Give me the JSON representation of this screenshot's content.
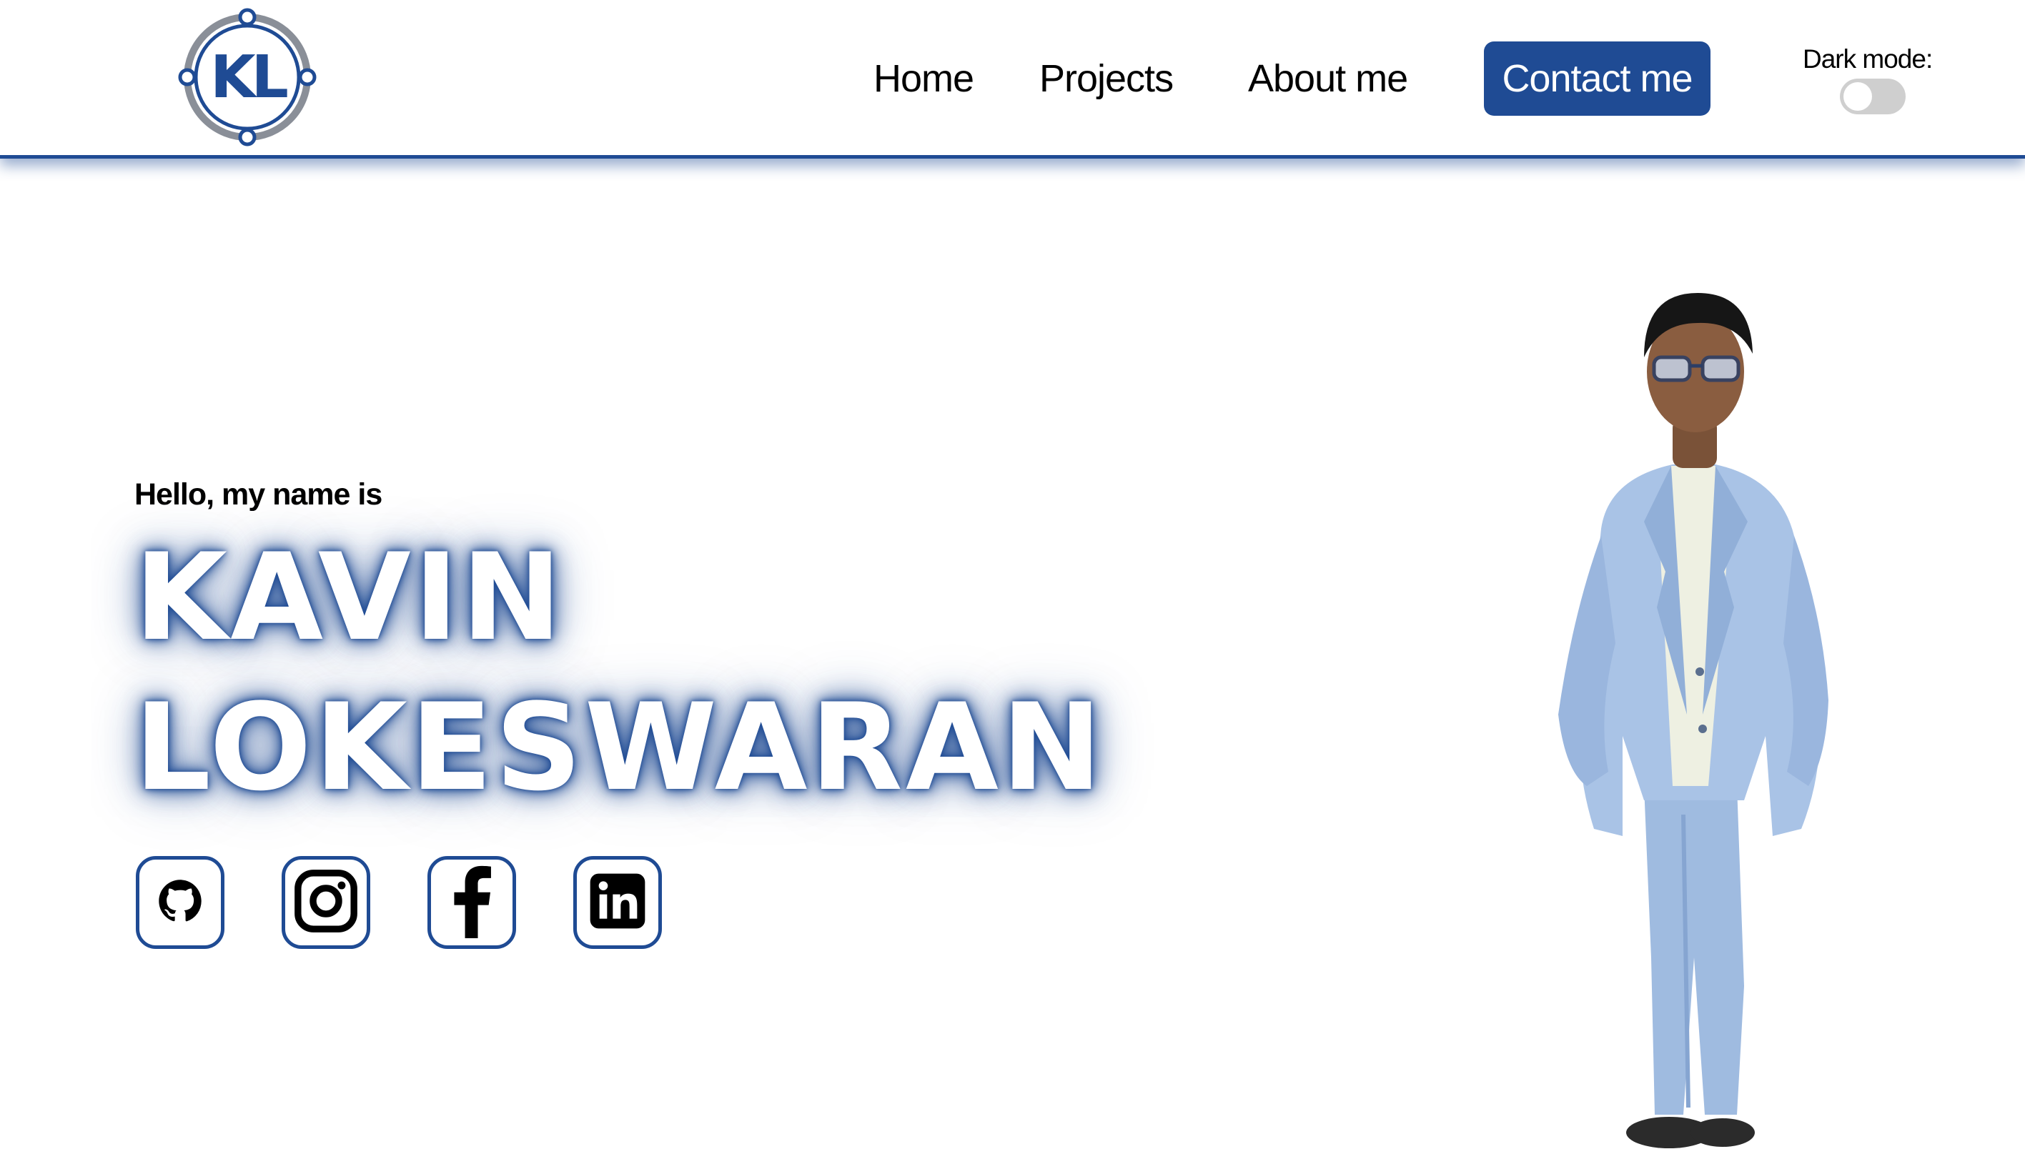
{
  "header": {
    "logo_text": "KL",
    "nav": [
      {
        "label": "Home"
      },
      {
        "label": "Projects"
      },
      {
        "label": "About me"
      }
    ],
    "contact_label": "Contact me",
    "dark_mode_label": "Dark mode:",
    "dark_mode_on": false
  },
  "hero": {
    "greeting": "Hello, my name is",
    "first_name": "KAVIN",
    "last_name": "LOKESWARAN"
  },
  "socials": [
    {
      "icon": "github-icon"
    },
    {
      "icon": "instagram-icon"
    },
    {
      "icon": "facebook-icon"
    },
    {
      "icon": "linkedin-icon"
    }
  ],
  "colors": {
    "accent": "#1f4b94",
    "background": "#ffffff",
    "toggle_off": "#cfcfcf"
  }
}
